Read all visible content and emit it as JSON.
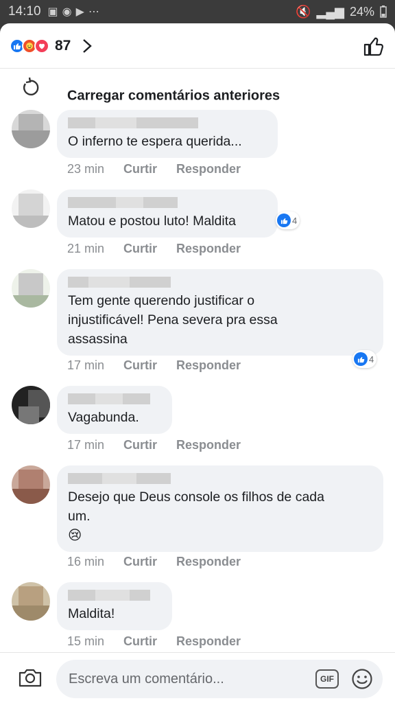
{
  "status_bar": {
    "time": "14:10",
    "battery": "24%"
  },
  "header": {
    "reaction_count": "87"
  },
  "load_previous": "Carregar comentários anteriores",
  "comments": [
    {
      "text": "O inferno te espera querida...",
      "time": "23 min",
      "like": "Curtir",
      "reply": "Responder",
      "reactions": null
    },
    {
      "text": "Matou e postou luto! Maldita",
      "time": "21 min",
      "like": "Curtir",
      "reply": "Responder",
      "reactions": "4"
    },
    {
      "text": "Tem gente querendo justificar o\ninjustificável! Pena severa pra essa\nassassina",
      "time": "17 min",
      "like": "Curtir",
      "reply": "Responder",
      "reactions": "4"
    },
    {
      "text": "Vagabunda.",
      "time": "17 min",
      "like": "Curtir",
      "reply": "Responder",
      "reactions": null
    },
    {
      "text": "Desejo que Deus console os filhos de cada\num.\n😢",
      "time": "16 min",
      "like": "Curtir",
      "reply": "Responder",
      "reactions": null
    },
    {
      "text": "Maldita!",
      "time": "15 min",
      "like": "Curtir",
      "reply": "Responder",
      "reactions": null
    }
  ],
  "composer": {
    "placeholder": "Escreva um comentário...",
    "gif_label": "GIF"
  },
  "colors": {
    "accent": "#1877f2",
    "bubble": "#f0f2f5",
    "meta": "#8a8d91"
  }
}
